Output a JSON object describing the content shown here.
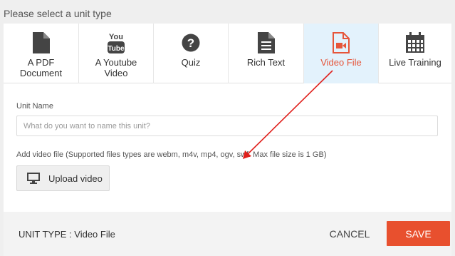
{
  "heading": "Please select a unit type",
  "unit_types": [
    {
      "label": "A PDF\nDocument",
      "icon": "file-icon",
      "active": false
    },
    {
      "label": "A Youtube\nVideo",
      "icon": "youtube-icon",
      "active": false
    },
    {
      "label": "Quiz",
      "icon": "question-icon",
      "active": false
    },
    {
      "label": "Rich Text",
      "icon": "document-text-icon",
      "active": false
    },
    {
      "label": "Video File",
      "icon": "video-file-icon",
      "active": true
    },
    {
      "label": "Live Training",
      "icon": "calendar-icon",
      "active": false
    }
  ],
  "unit_name": {
    "label": "Unit Name",
    "placeholder": "What do you want to name this unit?",
    "value": ""
  },
  "video_file": {
    "label": "Add video file (Supported files types are webm, m4v, mp4, ogv, swf. Max file size is 1 GB)",
    "upload_label": "Upload video",
    "upload_icon": "monitor-icon"
  },
  "footer": {
    "unit_type_text": "UNIT TYPE : Video File",
    "cancel_label": "CANCEL",
    "save_label": "SAVE"
  },
  "colors": {
    "accent": "#e8502e",
    "active_tab_bg": "#e3f2fc",
    "annotation_arrow": "#e0201c"
  }
}
